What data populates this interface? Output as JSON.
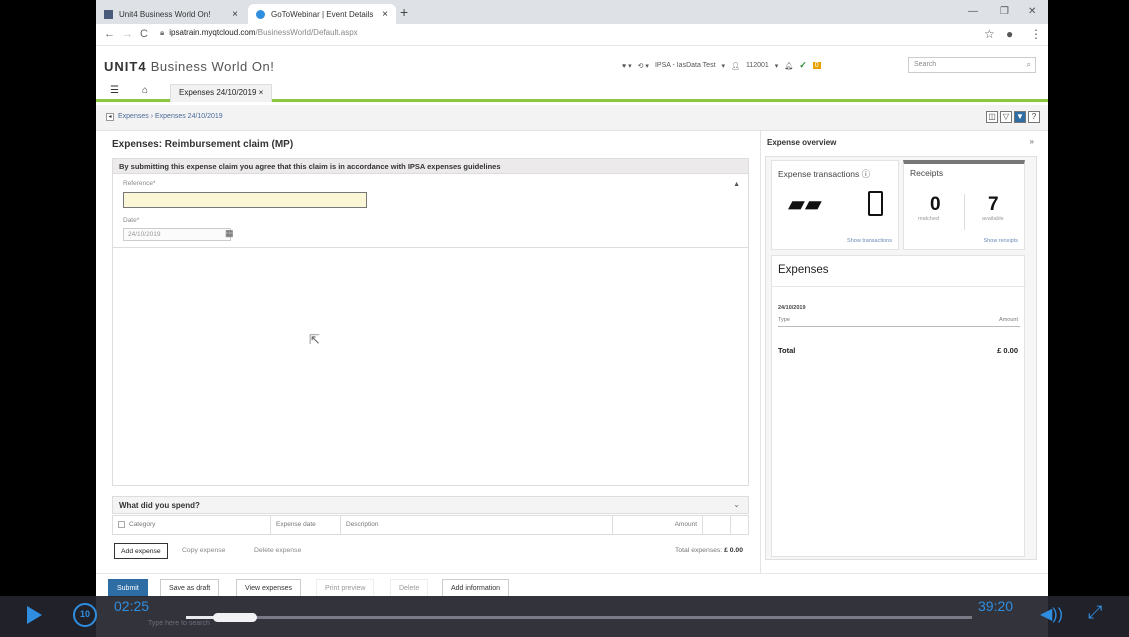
{
  "browser": {
    "tabs": [
      {
        "label": "Unit4 Business World On!"
      },
      {
        "label": "GoToWebinar | Event Details"
      }
    ],
    "url_host": "ipsatrain.myqtcloud.com",
    "url_path": "/BusinessWorld/Default.aspx"
  },
  "app": {
    "logo_brand": "UNIT4",
    "logo_product": "Business World On!",
    "header_tools": {
      "client": "IPSA - IasData Test",
      "user": "112001",
      "badge": "0"
    },
    "search_placeholder": "Search",
    "tab_label": "Expenses 24/10/2019"
  },
  "breadcrumb": {
    "root": "Expenses",
    "current": "Expenses 24/10/2019"
  },
  "form": {
    "title": "Expenses: Reimbursement claim (MP)",
    "notice": "By submitting this expense claim you agree that this claim is in accordance with IPSA expenses guidelines",
    "reference_label": "Reference*",
    "reference_value": "",
    "date_label": "Date*",
    "date_value": "24/10/2019"
  },
  "spend": {
    "heading": "What did you spend?",
    "columns": [
      "Category",
      "Expense date",
      "Description",
      "Amount"
    ],
    "add_label": "Add expense",
    "copy_label": "Copy expense",
    "delete_label": "Delete expense",
    "total_label": "Total expenses:",
    "total_value": "£ 0.00"
  },
  "overview": {
    "title": "Expense overview",
    "transactions_title": "Expense transactions",
    "transactions_link": "Show transactions",
    "receipts_title": "Receipts",
    "matched_count": "0",
    "matched_label": "matched",
    "available_count": "7",
    "available_label": "available",
    "receipts_link": "Show receipts",
    "expenses_title": "Expenses",
    "expenses_date": "24/10/2019",
    "type_header": "Type",
    "amount_header": "Amount",
    "total_label": "Total",
    "total_value": "£ 0.00"
  },
  "actions": {
    "submit": "Submit",
    "save_draft": "Save as draft",
    "view_expenses": "View expenses",
    "print_preview": "Print preview",
    "delete": "Delete",
    "add_information": "Add information"
  },
  "player": {
    "current_time": "02:25",
    "duration": "39:20",
    "progress": 0.062,
    "rewind_seconds": "10"
  },
  "taskbar": {
    "search_hint": "Type here to search"
  },
  "colors": {
    "accent_blue": "#2e6da4",
    "player_blue": "#2f8ee0",
    "tab_underline_green": "#8dc63f",
    "reference_highlight": "#fbf6d6"
  },
  "icons": [
    "menu-icon",
    "home-icon",
    "calendar-icon",
    "collapse-icon",
    "expand-chevron-icon",
    "credit-cards-icon",
    "mobile-phone-icon",
    "play-icon",
    "rewind-10-icon",
    "volume-icon",
    "fullscreen-icon"
  ]
}
